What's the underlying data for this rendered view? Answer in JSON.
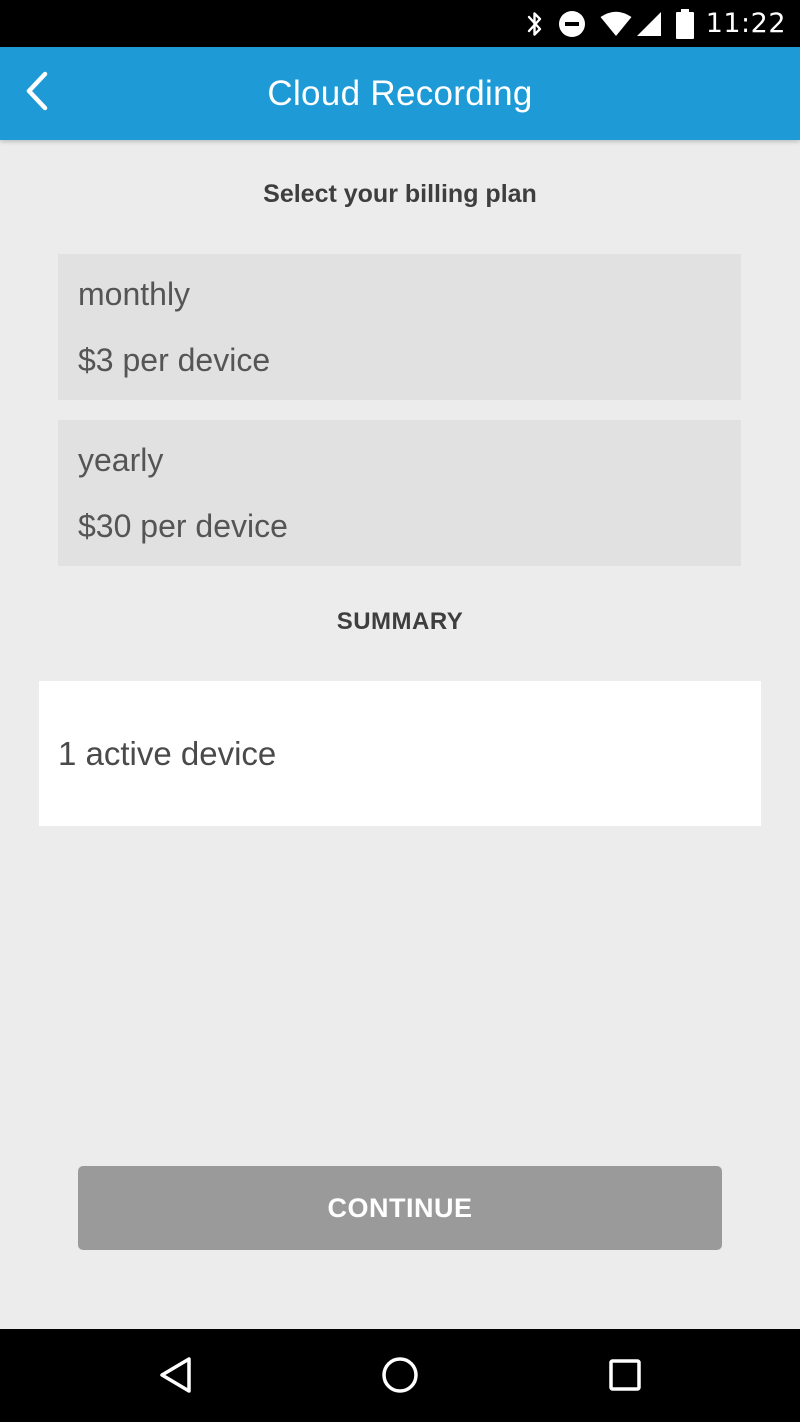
{
  "status_bar": {
    "time": "11:22",
    "icons": [
      "bluetooth-icon",
      "do-not-disturb-icon",
      "wifi-icon",
      "cell-signal-icon",
      "battery-icon"
    ]
  },
  "app_bar": {
    "title": "Cloud Recording",
    "back_icon": "chevron-left-icon",
    "background_color": "#1e9ad6"
  },
  "billing": {
    "heading": "Select your billing plan",
    "plans": [
      {
        "name": "monthly",
        "price": "$3 per device"
      },
      {
        "name": "yearly",
        "price": "$30 per device"
      }
    ]
  },
  "summary": {
    "heading": "SUMMARY",
    "text": "1 active device"
  },
  "continue_button": {
    "label": "CONTINUE",
    "color": "#9a9a9a"
  },
  "nav_bar": {
    "icons": [
      "back-triangle-icon",
      "home-circle-icon",
      "recents-square-icon"
    ]
  }
}
